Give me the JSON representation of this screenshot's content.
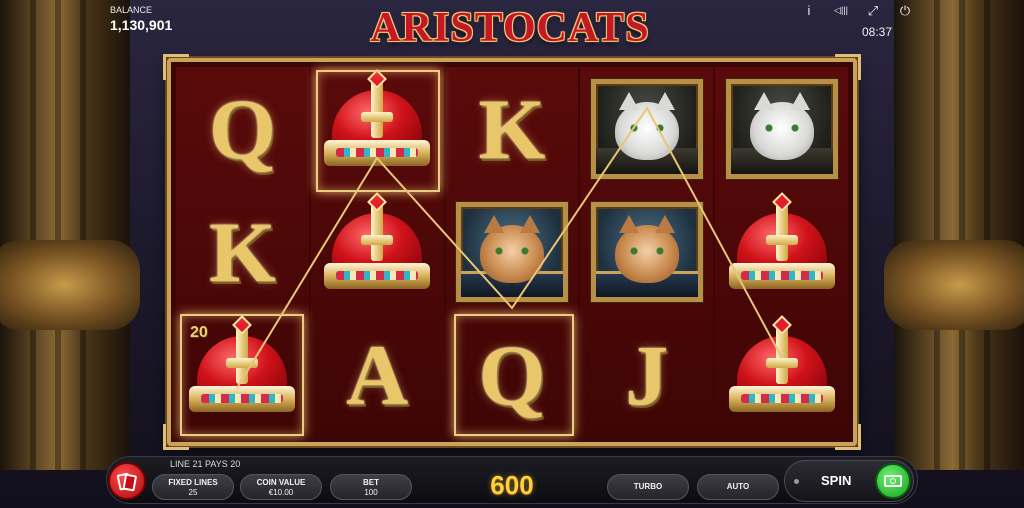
{
  "header": {
    "balance_label": "BALANCE",
    "balance_value": "1,130,901",
    "logo_text": "ARISTOCATS",
    "clock": "08:37",
    "icons": [
      "info-icon",
      "sound-icon",
      "fullscreen-icon",
      "power-icon"
    ],
    "icon_glyphs": {
      "info": "i",
      "sound": "◁|||",
      "fullscreen": "⤢",
      "power": "⏻"
    }
  },
  "reels": [
    [
      "Q",
      "crown",
      "K",
      "crown"
    ],
    [
      "crown",
      "crown",
      "A"
    ],
    [
      "K",
      "persian-cat",
      "Q"
    ],
    [
      "white-cat",
      "persian-cat",
      "J"
    ],
    [
      "white-cat",
      "crown",
      "crown"
    ]
  ],
  "symbols": {
    "r1_top": "Q",
    "r1_mid": "K",
    "r2_bot": "A",
    "r3_top": "K",
    "r3_bot": "Q",
    "r4_bot": "J"
  },
  "win": {
    "multiplier": "20",
    "line_info": "LINE 21 PAYS 20",
    "amount": "600"
  },
  "controls": {
    "fixed_lines_label": "FIXED LINES",
    "fixed_lines_value": "25",
    "coin_value_label": "COIN VALUE",
    "coin_value_value": "€10.00",
    "bet_label": "BET",
    "bet_value": "100",
    "turbo_label": "TURBO",
    "auto_label": "AUTO",
    "spin_label": "SPIN"
  },
  "colors": {
    "reel_bg": "#5a0a0a",
    "gold": "#e9c66a",
    "win_amount": "#ffcf3a",
    "spin_green": "#14a21e"
  }
}
